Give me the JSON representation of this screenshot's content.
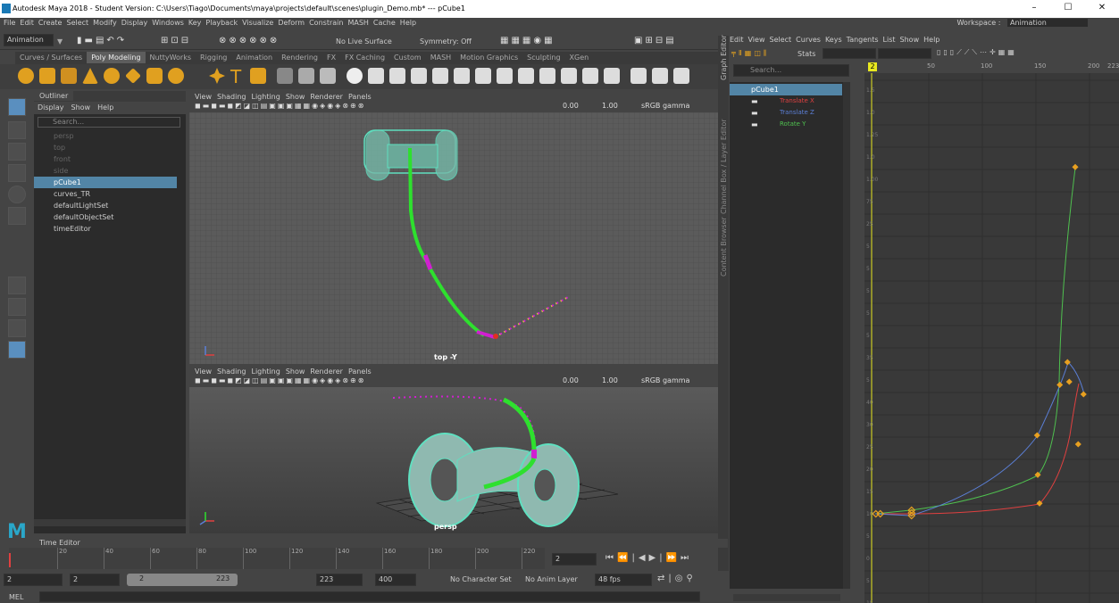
{
  "window": {
    "title": "Autodesk Maya 2018 - Student Version: C:\\Users\\Tiago\\Documents\\maya\\projects\\default\\scenes\\plugin_Demo.mb* --- pCube1",
    "minimize": "–",
    "maximize": "☐",
    "close": "✕"
  },
  "menubar": [
    "File",
    "Edit",
    "Create",
    "Select",
    "Modify",
    "Display",
    "Windows",
    "Key",
    "Playback",
    "Visualize",
    "Deform",
    "Constrain",
    "MASH",
    "Cache",
    "Help"
  ],
  "workspace": {
    "label": "Workspace :",
    "value": "Animation"
  },
  "toolbar": {
    "mode": "Animation",
    "live_surface": "No Live Surface",
    "symmetry": "Symmetry: Off"
  },
  "shelf_tabs": [
    "Curves / Surfaces",
    "Poly Modeling",
    "NuttyWorks",
    "Rigging",
    "Animation",
    "Rendering",
    "FX",
    "FX Caching",
    "Custom",
    "MASH",
    "Motion Graphics",
    "Sculpting",
    "XGen"
  ],
  "shelf_active": "Poly Modeling",
  "outliner": {
    "tab": "Outliner",
    "menu": [
      "Display",
      "Show",
      "Help"
    ],
    "search_placeholder": "Search...",
    "items": [
      {
        "label": "persp",
        "dim": true
      },
      {
        "label": "top",
        "dim": true
      },
      {
        "label": "front",
        "dim": true
      },
      {
        "label": "side",
        "dim": true
      },
      {
        "label": "pCube1",
        "selected": true
      },
      {
        "label": "curves_TR"
      },
      {
        "label": "defaultLightSet"
      },
      {
        "label": "defaultObjectSet"
      },
      {
        "label": "timeEditor"
      }
    ]
  },
  "viewport": {
    "menu": [
      "View",
      "Shading",
      "Lighting",
      "Show",
      "Renderer",
      "Panels"
    ],
    "exposure": "0.00",
    "gamma": "1.00",
    "colorspace": "sRGB gamma",
    "top_label": "top -Y",
    "persp_label": "persp"
  },
  "graph_editor": {
    "side_tab": "Graph Editor",
    "side_tab2": "Channel Box / Layer Editor",
    "side_tab3": "Content Browser",
    "menu": [
      "Edit",
      "View",
      "Select",
      "Curves",
      "Keys",
      "Tangents",
      "List",
      "Show",
      "Help"
    ],
    "stats": "Stats",
    "search_placeholder": "Search...",
    "object": "pCube1",
    "channels": [
      {
        "label": "Translate X",
        "color": "#e04040"
      },
      {
        "label": "Translate Z",
        "color": "#5b7fd6"
      },
      {
        "label": "Rotate Y",
        "color": "#4fc04f"
      }
    ],
    "frame_ruler": [
      "50",
      "100",
      "150",
      "200",
      "223"
    ],
    "current_frame": "2",
    "y_ticks": [
      "1.5",
      "1.0",
      "1.25",
      "1.0",
      "1.00",
      "75",
      "25",
      "5",
      "5",
      "5",
      "5",
      "5",
      "35",
      "5",
      "40",
      "30",
      "25",
      "20",
      "15",
      "10",
      "5",
      "0",
      "5",
      "15"
    ]
  },
  "time_editor": {
    "label": "Time Editor"
  },
  "time_slider": {
    "ticks": [
      "20",
      "40",
      "60",
      "80",
      "100",
      "120",
      "140",
      "160",
      "180",
      "200",
      "220"
    ],
    "current": "2",
    "start": "2"
  },
  "range_bar": {
    "start": "2",
    "inner_start": "2",
    "range_label_left": "2",
    "range_label_right": "223",
    "end": "223",
    "anim_end": "400",
    "character_set": "No Character Set",
    "anim_layer": "No Anim Layer",
    "fps": "48 fps"
  },
  "mel": {
    "label": "MEL"
  },
  "colors": {
    "accent_select": "#5285a6",
    "curve_green": "#2ee02e",
    "curve_magenta": "#d020d0",
    "curve_yellow": "#e8e820",
    "mesh_teal": "#5fe0c0"
  }
}
